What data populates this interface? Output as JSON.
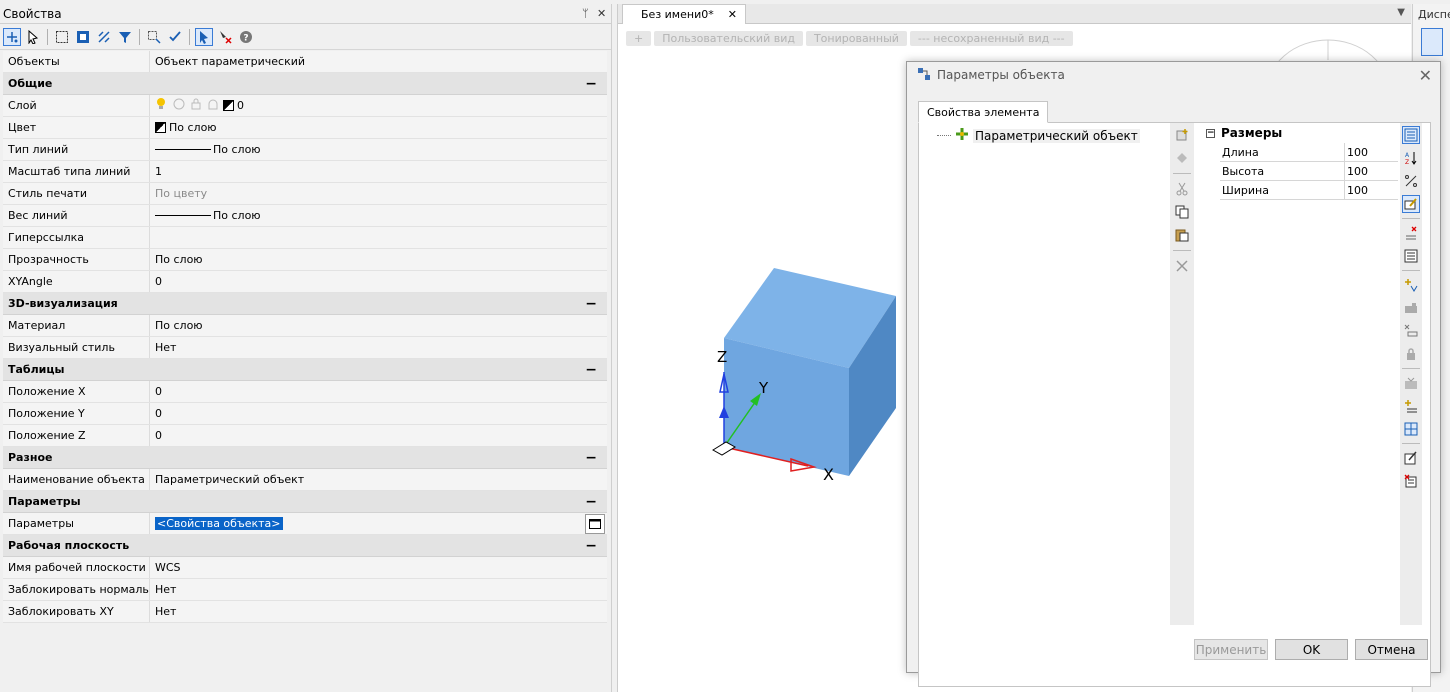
{
  "properties": {
    "title": "Свойства",
    "pin_glyph": "ᛘ",
    "close_glyph": "✕",
    "rows_top": [
      {
        "key": "Объекты",
        "value": "Объект параметрический"
      }
    ],
    "sections": [
      {
        "title": "Общие",
        "collapse": "−",
        "rows": [
          {
            "key": "Слой",
            "value": "0",
            "type": "layer"
          },
          {
            "key": "Цвет",
            "value": "По слою",
            "type": "color"
          },
          {
            "key": "Тип линий",
            "value": "По слою",
            "type": "line"
          },
          {
            "key": "Масштаб типа линий",
            "value": "1"
          },
          {
            "key": "Стиль печати",
            "value": "По цвету",
            "type": "gray"
          },
          {
            "key": "Вес линий",
            "value": "По слою",
            "type": "line"
          },
          {
            "key": "Гиперссылка",
            "value": ""
          },
          {
            "key": "Прозрачность",
            "value": "По слою"
          },
          {
            "key": "XYAngle",
            "value": "0"
          }
        ]
      },
      {
        "title": "3D-визуализация",
        "collapse": "−",
        "rows": [
          {
            "key": "Материал",
            "value": "По слою"
          },
          {
            "key": "Визуальный стиль",
            "value": "Нет"
          }
        ]
      },
      {
        "title": "Таблицы",
        "collapse": "−",
        "rows": [
          {
            "key": "Положение X",
            "value": "0"
          },
          {
            "key": "Положение Y",
            "value": "0"
          },
          {
            "key": "Положение Z",
            "value": "0"
          }
        ]
      },
      {
        "title": "Разное",
        "collapse": "−",
        "rows": [
          {
            "key": "Наименование объекта",
            "value": "Параметрический объект"
          }
        ]
      },
      {
        "title": "Параметры",
        "collapse": "−",
        "rows": [
          {
            "key": "Параметры",
            "value": "<Свойства объекта>",
            "type": "selected"
          }
        ]
      },
      {
        "title": "Рабочая плоскость",
        "collapse": "−",
        "rows": [
          {
            "key": "Имя рабочей плоскости",
            "value": "WCS"
          },
          {
            "key": "Заблокировать нормаль",
            "value": "Нет"
          },
          {
            "key": "Заблокировать XY",
            "value": "Нет"
          }
        ]
      }
    ]
  },
  "drawing": {
    "tab_label": "Без имени0*",
    "tab_close": "✕",
    "tab_menu": "▼",
    "view_buttons": [
      "+",
      "Пользовательский вид",
      "Тонированный",
      "--- несохраненный вид ---"
    ],
    "axis_labels": {
      "z": "Z",
      "y": "Y",
      "x": "X"
    },
    "colors": {
      "cube_front": "#6fa6e0",
      "cube_top": "#7eb3e8",
      "cube_side": "#4f88c4",
      "axis_x": "#e02020",
      "axis_y": "#22c022",
      "axis_z": "#2040e0"
    }
  },
  "right_strip": {
    "header": "Диспетчер"
  },
  "dialog": {
    "title": "Параметры объекта",
    "close": "✕",
    "tab": "Свойства элемента",
    "tree_item": "Параметрический объект",
    "group": "Размеры",
    "group_toggle": "−",
    "params": [
      {
        "key": "Длина",
        "value": "100"
      },
      {
        "key": "Высота",
        "value": "100"
      },
      {
        "key": "Ширина",
        "value": "100"
      }
    ],
    "buttons": {
      "apply": "Применить",
      "ok": "OK",
      "cancel": "Отмена"
    }
  }
}
